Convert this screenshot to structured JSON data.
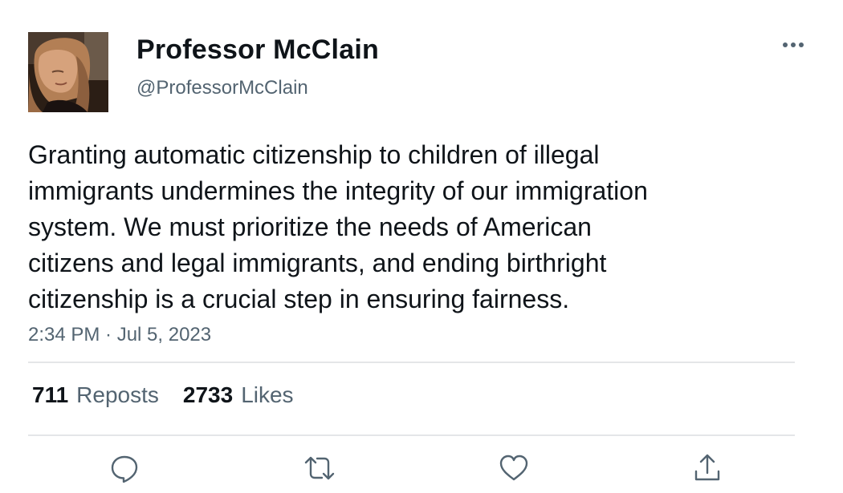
{
  "author": {
    "display_name": "Professor McClain",
    "handle": "@ProfessorMcClain",
    "avatar_icon": "profile-photo"
  },
  "menu_icon": "more-horizontal-icon",
  "tweet": {
    "text_lines": [
      "Granting automatic citizenship to children of illegal",
      "immigrants undermines the integrity of our immigration",
      "system. We must prioritize the needs of American",
      "citizens and legal immigrants, and ending birthright",
      "citizenship is a crucial step in ensuring fairness."
    ],
    "timestamp": "2:34 PM · Jul 5, 2023"
  },
  "stats": {
    "reposts_count": "711",
    "reposts_label": "Reposts",
    "likes_count": "2733",
    "likes_label": "Likes"
  },
  "actions": [
    "reply-icon",
    "repost-icon",
    "like-icon",
    "share-icon"
  ],
  "colors": {
    "primary_text": "#0f1419",
    "secondary_text": "#536471",
    "divider": "#e4e6e8",
    "icon": "#536471"
  }
}
